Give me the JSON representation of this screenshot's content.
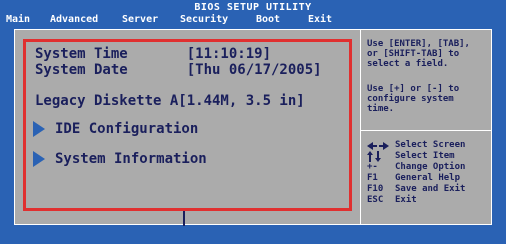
{
  "title": "BIOS SETUP UTILITY",
  "menu": [
    {
      "label": "Main"
    },
    {
      "label": "Advanced"
    },
    {
      "label": "Server"
    },
    {
      "label": "Security"
    },
    {
      "label": "Boot"
    },
    {
      "label": "Exit"
    }
  ],
  "fields": {
    "system_time": "System Time       [11:10:19]",
    "system_date": "System Date       [Thu 06/17/2005]",
    "legacy_diskette": "Legacy Diskette A[1.44M, 3.5 in]"
  },
  "submenus": [
    {
      "label": "IDE Configuration"
    },
    {
      "label": "System Information"
    }
  ],
  "help": {
    "line1": "Use [ENTER], [TAB],",
    "line2": "or [SHIFT-TAB] to",
    "line3": "select a field.",
    "line4": "Use [+] or [-] to",
    "line5": "configure system",
    "line6": "time."
  },
  "keys": [
    {
      "key": "",
      "desc": "Select Screen",
      "icon": "left-right-arrows"
    },
    {
      "key": "",
      "desc": "Select Item",
      "icon": "up-down-arrows"
    },
    {
      "key": "+-",
      "desc": "Change Option"
    },
    {
      "key": "F1",
      "desc": "General Help"
    },
    {
      "key": "F10",
      "desc": "Save and Exit"
    },
    {
      "key": "ESC",
      "desc": "Exit"
    }
  ],
  "colors": {
    "background": "#2a62b4",
    "panel": "#ababab",
    "text": "#1a1f5c",
    "highlight_frame": "#e03030"
  }
}
